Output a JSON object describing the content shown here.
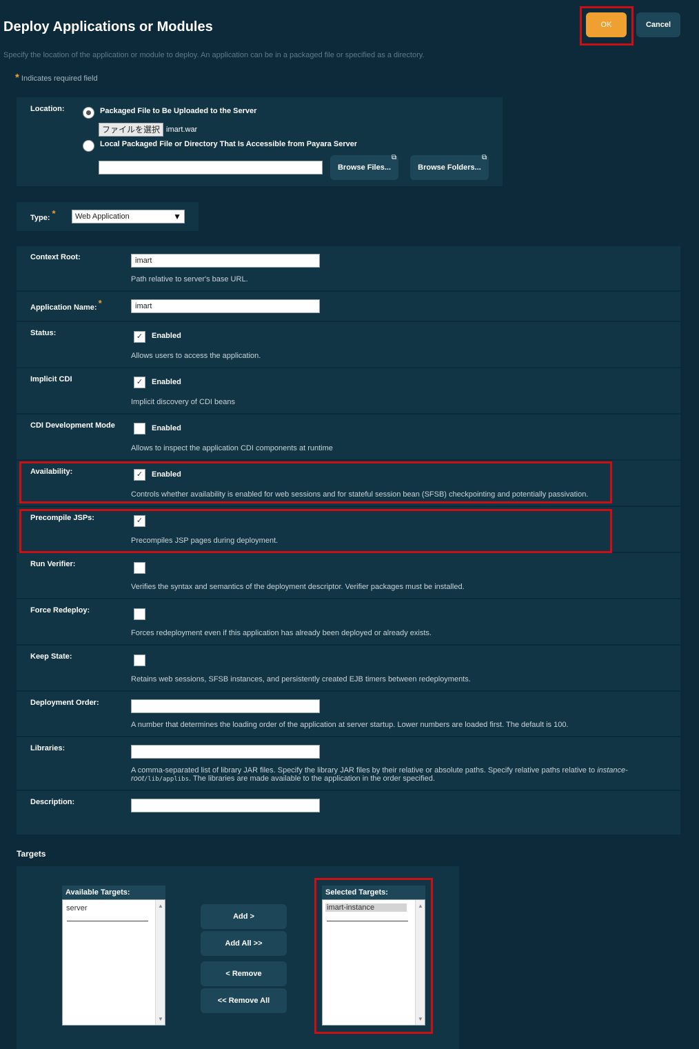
{
  "header": {
    "title": "Deploy Applications or Modules",
    "subtitle": "Specify the location of the application or module to deploy. An application can be in a packaged file or specified as a directory.",
    "required_star": "*",
    "required_note": "Indicates required field",
    "ok_label": "OK",
    "cancel_label": "Cancel"
  },
  "location": {
    "label": "Location:",
    "option_upload": "Packaged File to Be Uploaded to the Server",
    "choose_file_label": "ファイルを選択",
    "chosen_file": "imart.war",
    "option_local": "Local Packaged File or Directory That Is Accessible from Payara Server",
    "local_path_value": "",
    "browse_files_label": "Browse Files...",
    "browse_folders_label": "Browse Folders..."
  },
  "type": {
    "label": "Type:",
    "star": "*",
    "selected": "Web Application"
  },
  "form": {
    "context_root": {
      "label": "Context Root:",
      "value": "imart",
      "help": "Path relative to server's base URL."
    },
    "application_name": {
      "label": "Application Name:",
      "star": "*",
      "value": "imart"
    },
    "status": {
      "label": "Status:",
      "checked": true,
      "check_label": "Enabled",
      "help": "Allows users to access the application."
    },
    "implicit_cdi": {
      "label": "Implicit CDI",
      "checked": true,
      "check_label": "Enabled",
      "help": "Implicit discovery of CDI beans"
    },
    "cdi_dev_mode": {
      "label": "CDI Development Mode",
      "checked": false,
      "check_label": "Enabled",
      "help": "Allows to inspect the application CDI components at runtime"
    },
    "availability": {
      "label": "Availability:",
      "checked": true,
      "check_label": "Enabled",
      "help": "Controls whether availability is enabled for web sessions and for stateful session bean (SFSB) checkpointing and potentially passivation."
    },
    "precompile_jsps": {
      "label": "Precompile JSPs:",
      "checked": true,
      "help": "Precompiles JSP pages during deployment."
    },
    "run_verifier": {
      "label": "Run Verifier:",
      "checked": false,
      "help": "Verifies the syntax and semantics of the deployment descriptor. Verifier packages must be installed."
    },
    "force_redeploy": {
      "label": "Force Redeploy:",
      "checked": false,
      "help": "Forces redeployment even if this application has already been deployed or already exists."
    },
    "keep_state": {
      "label": "Keep State:",
      "checked": false,
      "help": "Retains web sessions, SFSB instances, and persistently created EJB timers between redeployments."
    },
    "deployment_order": {
      "label": "Deployment Order:",
      "value": "",
      "help": "A number that determines the loading order of the application at server startup. Lower numbers are loaded first. The default is 100."
    },
    "libraries": {
      "label": "Libraries:",
      "value": "",
      "help_1": "A comma-separated list of library JAR files. Specify the library JAR files by their relative or absolute paths. Specify relative paths relative to ",
      "help_italic_1": "instance-root",
      "help_code": "/lib/applibs",
      "help_2": ". The libraries are made available to the application in the order specified."
    },
    "description": {
      "label": "Description:",
      "value": ""
    }
  },
  "targets": {
    "heading": "Targets",
    "available_header": "Available Targets:",
    "available": [
      "server"
    ],
    "selected_header": "Selected Targets:",
    "selected": [
      "imart-instance"
    ],
    "add_label": "Add >",
    "add_all_label": "Add All >>",
    "remove_label": "< Remove",
    "remove_all_label": "<< Remove All"
  },
  "icons": {
    "external_link": "⧉",
    "dropdown_arrow": "▼",
    "check_mark": "✓"
  },
  "colors": {
    "background": "#0c2a3a",
    "panel": "#123546",
    "button": "#1d4658",
    "primary": "#f0a030",
    "highlight": "#cc0f12"
  }
}
